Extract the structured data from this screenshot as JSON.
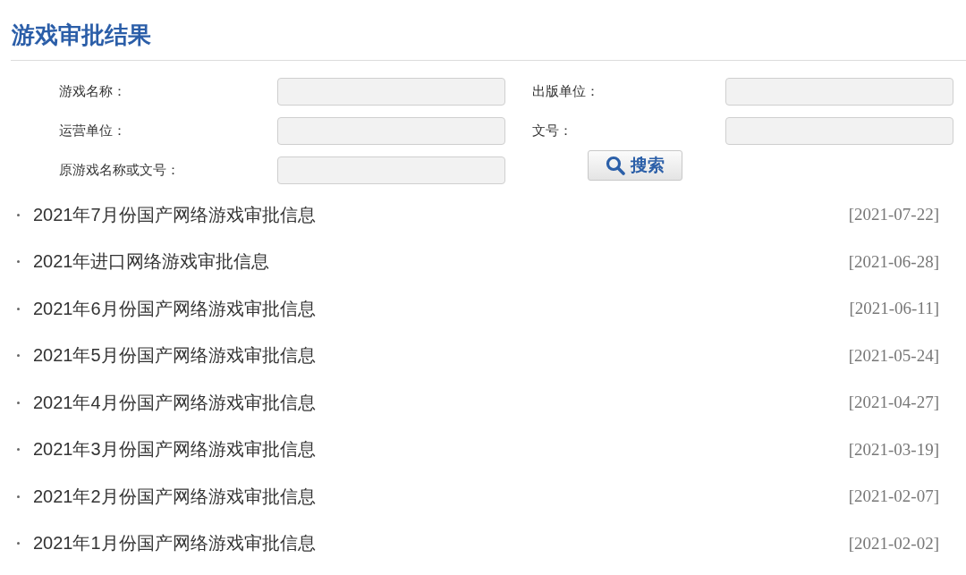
{
  "page_title": "游戏审批结果",
  "search_form": {
    "fields": [
      {
        "label": "游戏名称："
      },
      {
        "label": "出版单位："
      },
      {
        "label": "运营单位："
      },
      {
        "label": "文号："
      },
      {
        "label": "原游戏名称或文号："
      }
    ],
    "search_button": "搜索"
  },
  "results": [
    {
      "title": "2021年7月份国产网络游戏审批信息",
      "date": "[2021-07-22]"
    },
    {
      "title": "2021年进口网络游戏审批信息",
      "date": "[2021-06-28]"
    },
    {
      "title": "2021年6月份国产网络游戏审批信息",
      "date": "[2021-06-11]"
    },
    {
      "title": "2021年5月份国产网络游戏审批信息",
      "date": "[2021-05-24]"
    },
    {
      "title": "2021年4月份国产网络游戏审批信息",
      "date": "[2021-04-27]"
    },
    {
      "title": "2021年3月份国产网络游戏审批信息",
      "date": "[2021-03-19]"
    },
    {
      "title": "2021年2月份国产网络游戏审批信息",
      "date": "[2021-02-07]"
    },
    {
      "title": "2021年1月份国产网络游戏审批信息",
      "date": "[2021-02-02]"
    }
  ]
}
